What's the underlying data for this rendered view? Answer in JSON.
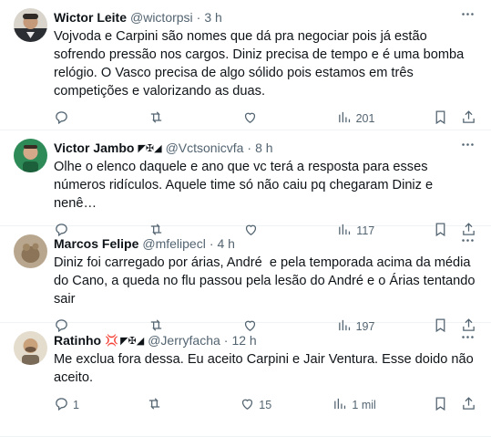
{
  "tweets": [
    {
      "name": "Wictor Leite",
      "handle": "@wictorpsi",
      "time": "3 h",
      "dot": "·",
      "text": "Vojvoda e Carpini são nomes que dá pra negociar pois já estão sofrendo pressão nos cargos. Diniz precisa de tempo e é uma bomba relógio. O Vasco precisa de algo sólido pois estamos em três competições e valorizando as duas.",
      "replies": "",
      "retweets": "",
      "likes": "",
      "views": "201",
      "avatar_color": "#2b2f33"
    },
    {
      "name": "Victor Jambo",
      "flags": "◤✠◢",
      "handle": "@Vctsonicvfa",
      "time": "8 h",
      "dot": "·",
      "text": "Olhe o elenco daquele e ano que vc terá a resposta para esses números ridículos. Aquele time só não caiu pq chegaram Diniz e nenê…",
      "replies": "",
      "retweets": "",
      "likes": "",
      "views": "117",
      "avatar_color": "#2e8b57"
    },
    {
      "name": "Marcos Felipe",
      "handle": "@mfelipecl",
      "time": "4 h",
      "dot": "·",
      "text": "Diniz foi carregado por árias, André  e pela temporada acima da média do Cano, a queda no flu passou pela lesão do André e o Árias tentando sair",
      "replies": "",
      "retweets": "",
      "likes": "",
      "views": "197",
      "avatar_color": "#b8a78e"
    },
    {
      "name": "Ratinho",
      "emoji": "💢",
      "flags": "◤✠◢",
      "handle": "@Jerryfacha",
      "time": "12 h",
      "dot": "·",
      "text": "Me exclua fora dessa. Eu aceito Carpini e Jair Ventura. Esse doido não aceito.",
      "replies": "1",
      "retweets": "",
      "likes": "15",
      "views": "1 mil",
      "avatar_color": "#c9b79c"
    }
  ],
  "colors": {
    "text": "#0f1419",
    "muted": "#536471",
    "divider": "#eff3f4"
  },
  "icons": [
    "more-icon",
    "reply-icon",
    "retweet-icon",
    "like-icon",
    "views-icon",
    "bookmark-icon",
    "share-icon"
  ]
}
